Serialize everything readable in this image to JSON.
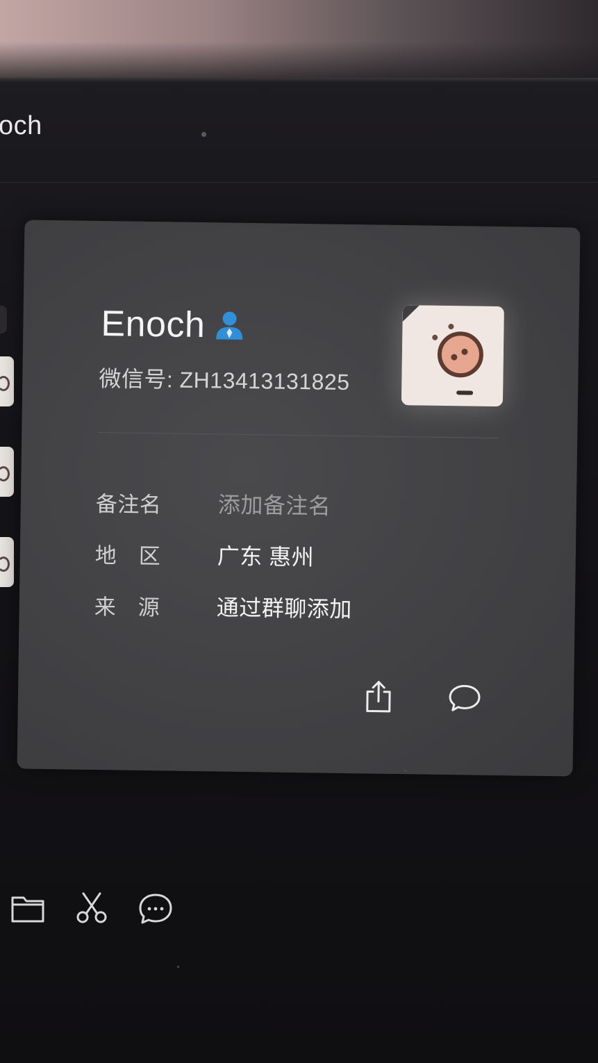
{
  "window": {
    "title_fragment": "och"
  },
  "profile": {
    "name": "Enoch",
    "wechat_id": "微信号: ZH13413131825",
    "avatar_icon": "pig-face-avatar",
    "contact_icon": "person-contact-icon",
    "accent_color": "#2f8fd8"
  },
  "details": [
    {
      "label": "备注名",
      "value": "添加备注名",
      "placeholder": true
    },
    {
      "label": "地　区",
      "value": "广东 惠州",
      "placeholder": false
    },
    {
      "label": "来　源",
      "value": "通过群聊添加",
      "placeholder": false
    }
  ],
  "actions": {
    "share_icon": "share-icon",
    "message_icon": "chat-bubble-icon"
  },
  "toolbar": {
    "items": [
      "folder-icon",
      "scissors-icon",
      "chat-dots-icon"
    ]
  }
}
